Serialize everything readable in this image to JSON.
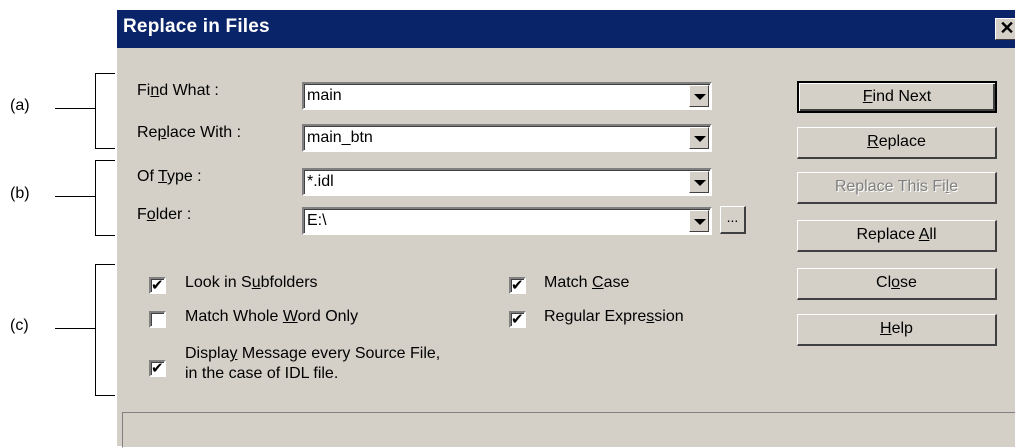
{
  "annotations": {
    "a": "(a)",
    "b": "(b)",
    "c": "(c)"
  },
  "dialog": {
    "title": "Replace in Files",
    "close_glyph": "✕"
  },
  "fields": {
    "find_what": {
      "label_pre": "Fi",
      "label_key": "n",
      "label_post": "d What :",
      "value": "main"
    },
    "replace_with": {
      "label_pre": "Re",
      "label_key": "p",
      "label_post": "lace With :",
      "value": "main_btn"
    },
    "of_type": {
      "label_pre": "Of ",
      "label_key": "T",
      "label_post": "ype :",
      "value": "*.idl"
    },
    "folder": {
      "label_pre": "F",
      "label_key": "o",
      "label_post": "lder :",
      "value": "E:\\",
      "browse_label": "..."
    }
  },
  "options": {
    "look_subfolders": {
      "pre": "Look in S",
      "key": "u",
      "post": "bfolders",
      "checked": true
    },
    "whole_word": {
      "pre": "Match Whole ",
      "key": "W",
      "post": "ord Only",
      "checked": false
    },
    "match_case": {
      "pre": "Match ",
      "key": "C",
      "post": "ase",
      "checked": true
    },
    "regex": {
      "pre": "Regular Expre",
      "key": "s",
      "post": "sion",
      "checked": true
    },
    "display_message": {
      "line1_pre": "Displa",
      "line1_key": "y",
      "line1_post": " Message every Source File,",
      "line2": "in the case of IDL file.",
      "checked": true
    }
  },
  "buttons": {
    "find_next": {
      "pre": "",
      "key": "F",
      "post": "ind Next"
    },
    "replace": {
      "pre": "",
      "key": "R",
      "post": "eplace"
    },
    "replace_file": {
      "pre": "Replace This Fi",
      "key": "l",
      "post": "e"
    },
    "replace_all": {
      "pre": "Replace ",
      "key": "A",
      "post": "ll"
    },
    "close": {
      "pre": "Cl",
      "key": "o",
      "post": "se"
    },
    "help": {
      "pre": "",
      "key": "H",
      "post": "elp"
    }
  }
}
